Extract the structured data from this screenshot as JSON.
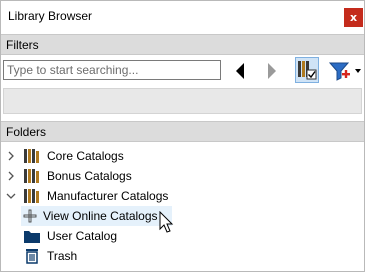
{
  "window": {
    "title": "Library Browser",
    "close_label": "x"
  },
  "filters": {
    "header": "Filters",
    "search_placeholder": "Type to start searching...",
    "search_value": ""
  },
  "folders": {
    "header": "Folders",
    "items": [
      {
        "label": "Core Catalogs",
        "icon": "books-icon",
        "expanded": false
      },
      {
        "label": "Bonus Catalogs",
        "icon": "books-icon",
        "expanded": false
      },
      {
        "label": "Manufacturer Catalogs",
        "icon": "books-icon",
        "expanded": true
      },
      {
        "label": "View Online Catalogs",
        "icon": "plus-icon",
        "hovered": true
      },
      {
        "label": "User Catalog",
        "icon": "folder-icon"
      },
      {
        "label": "Trash",
        "icon": "trash-icon"
      }
    ]
  },
  "colors": {
    "close": "#c42b1c",
    "section_header": "#dcdcdc",
    "hover": "#e5f1fb",
    "accent": "#2b6cc4"
  }
}
